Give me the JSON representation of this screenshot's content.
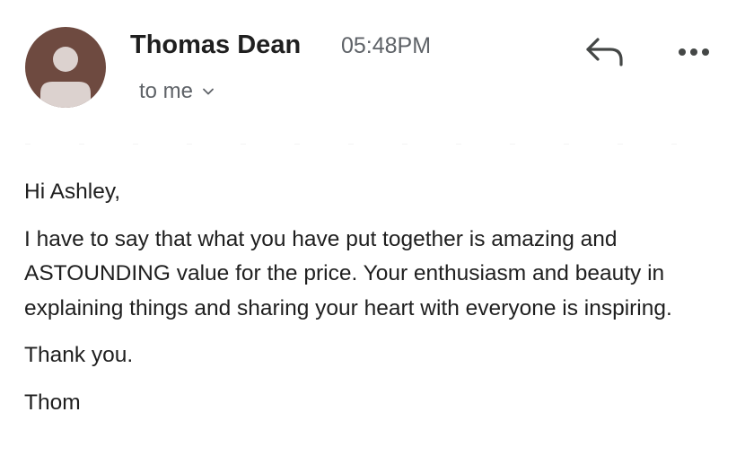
{
  "header": {
    "sender_name": "Thomas Dean",
    "timestamp": "05:48PM",
    "recipient_label": "to me",
    "avatar_color": "#6e4a40",
    "icons": {
      "reply": "reply-arrow-icon",
      "more": "more-options-icon",
      "expand": "chevron-down-icon"
    }
  },
  "message": {
    "greeting": "Hi Ashley,",
    "paragraph": "I have to say that what you have put together is amazing and ASTOUNDING value for the price. Your enthusiasm and beauty in explaining things and sharing your heart with everyone is inspiring.",
    "thanks": "Thank you.",
    "signature": "Thom"
  }
}
